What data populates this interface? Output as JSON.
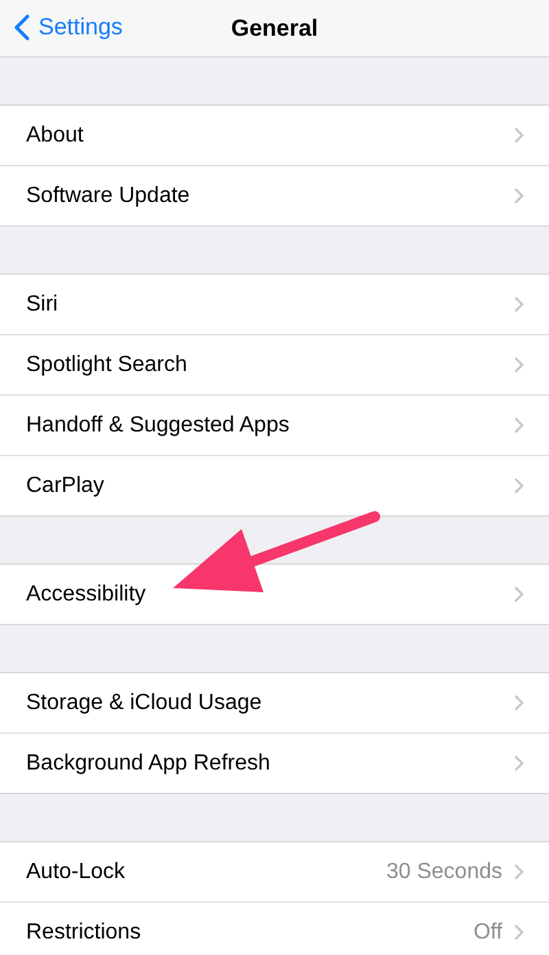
{
  "nav_bar": {
    "back_label": "Settings",
    "title": "General"
  },
  "groups": [
    {
      "rows": [
        {
          "label": "About"
        },
        {
          "label": "Software Update"
        }
      ]
    },
    {
      "rows": [
        {
          "label": "Siri"
        },
        {
          "label": "Spotlight Search"
        },
        {
          "label": "Handoff & Suggested Apps"
        },
        {
          "label": "CarPlay"
        }
      ]
    },
    {
      "rows": [
        {
          "label": "Accessibility"
        }
      ]
    },
    {
      "rows": [
        {
          "label": "Storage & iCloud Usage"
        },
        {
          "label": "Background App Refresh"
        }
      ]
    },
    {
      "rows": [
        {
          "label": "Auto-Lock",
          "value": "30 Seconds"
        },
        {
          "label": "Restrictions",
          "value": "Off"
        }
      ]
    }
  ]
}
